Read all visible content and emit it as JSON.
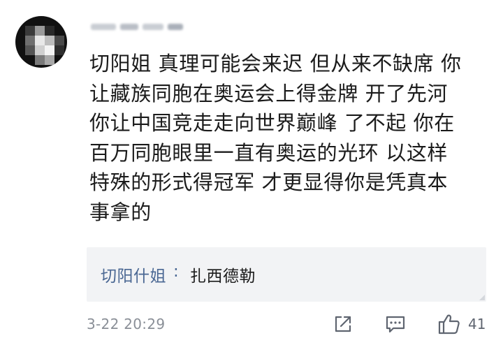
{
  "comment": {
    "lines": [
      "切阳姐 真理可能会来迟 但从来不缺席 你",
      "让藏族同胞在奥运会上得金牌 开了先河",
      "你让中国竞走走向世界巅峰 了不起  你在",
      "百万同胞眼里一直有奥运的光环 以这样",
      "特殊的形式得冠军 才更显得你是凭真本",
      "事拿的"
    ],
    "timestamp": "3-22 20:29"
  },
  "reply": {
    "author": "切阳什姐",
    "separator": ":",
    "text": "扎西德勒"
  },
  "actions": {
    "share_icon": "share-icon",
    "reply_icon": "comment-icon",
    "like_icon": "thumbs-up-icon",
    "like_count": "41"
  },
  "colors": {
    "reply_author": "#4a6793",
    "reply_background": "#f2f3f5",
    "meta_text": "#8a8f97"
  }
}
